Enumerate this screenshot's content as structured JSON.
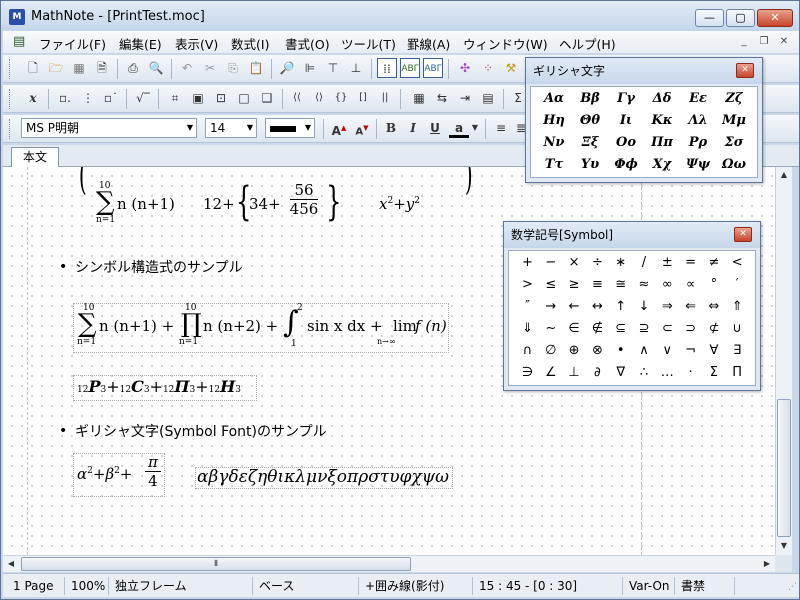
{
  "window": {
    "app_icon": "M",
    "title": "MathNote - [PrintTest.moc]"
  },
  "menu": [
    "ファイル(F)",
    "編集(E)",
    "表示(V)",
    "数式(I)",
    "書式(O)",
    "ツール(T)",
    "罫線(A)",
    "ウィンドウ(W)",
    "ヘルプ(H)"
  ],
  "toolbar3": {
    "font": "MS P明朝",
    "size": "14",
    "bold": "B",
    "italic": "I",
    "underline": "U",
    "text_color": "a"
  },
  "tab": {
    "label": "本文"
  },
  "document": {
    "eq1": {
      "sum_upper": "10",
      "sum_lower": "n=1",
      "body": "n (n+1)",
      "plus": "12+",
      "inner": "34+",
      "num": "56",
      "den": "456",
      "x": "x",
      "y": "y",
      "exp": "2"
    },
    "section1": "シンボル構造式のサンプル",
    "eq2": {
      "sum_upper": "10",
      "sum_lower": "n=1",
      "sum_body": "n (n+1) +",
      "prod_upper": "10",
      "prod_lower": "n=1",
      "prod_body": "n (n+2) +",
      "int_upper": "2",
      "int_lower": "1",
      "int_body": "sin x dx +",
      "lim": "lim",
      "lim_sub": "n→∞",
      "lim_body": "f (n)"
    },
    "eq3": {
      "pre": "12",
      "P": "P",
      "sub": "3",
      "C": "C",
      "Pi": "Π",
      "H": "H",
      "plus": "+"
    },
    "section2": "ギリシャ文字(Symbol Font)のサンプル",
    "eq4": {
      "alpha": "α",
      "beta": "β",
      "exp": "2",
      "pi": "π",
      "four": "4"
    },
    "greek_line": "αβγδεζηθικλμνξοπρστυφχψω"
  },
  "greek_palette": {
    "title": "ギリシャ文字",
    "cells": [
      "Αα",
      "Ββ",
      "Γγ",
      "Δδ",
      "Εε",
      "Ζζ",
      "Ηη",
      "Θθ",
      "Ιι",
      "Κκ",
      "Λλ",
      "Μμ",
      "Νν",
      "Ξξ",
      "Οο",
      "Ππ",
      "Ρρ",
      "Σσ",
      "Ττ",
      "Υυ",
      "Φϕ",
      "Χχ",
      "Ψψ",
      "Ωω"
    ]
  },
  "symbol_palette": {
    "title": "数学記号[Symbol]",
    "cells": [
      "+",
      "−",
      "×",
      "÷",
      "∗",
      "/",
      "±",
      "=",
      "≠",
      "<",
      ">",
      "≤",
      "≥",
      "≡",
      "≅",
      "≈",
      "∞",
      "∝",
      "°",
      "′",
      "″",
      "→",
      "←",
      "↔",
      "↑",
      "↓",
      "⇒",
      "⇐",
      "⇔",
      "⇑",
      "⇓",
      "~",
      "∈",
      "∉",
      "⊆",
      "⊇",
      "⊂",
      "⊃",
      "⊄",
      "∪",
      "∩",
      "∅",
      "⊕",
      "⊗",
      "•",
      "∧",
      "∨",
      "¬",
      "∀",
      "∃",
      "∋",
      "∠",
      "⊥",
      "∂",
      "∇",
      "∴",
      "…",
      "·",
      "Σ",
      "Π"
    ]
  },
  "status": [
    "1 Page",
    "100%",
    "独立フレーム",
    "ベース",
    "+囲み線(影付)",
    "15 : 45 - [0 : 30]",
    "Var-On",
    "書禁"
  ]
}
